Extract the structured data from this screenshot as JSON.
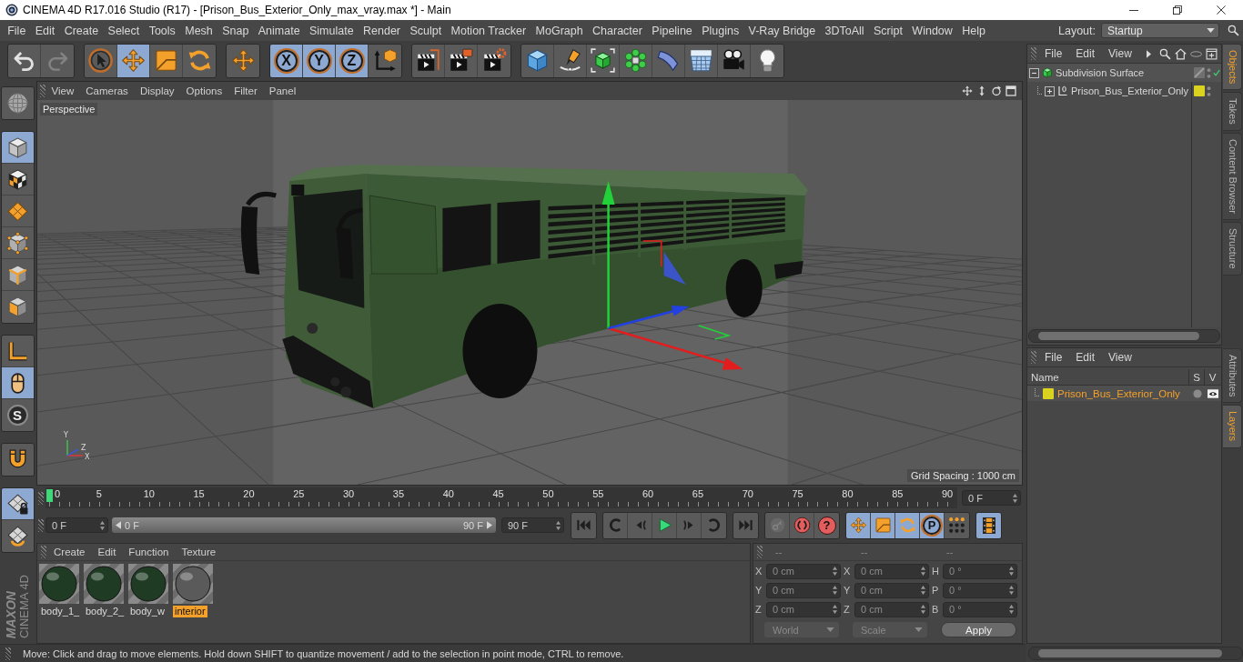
{
  "window": {
    "title": "CINEMA 4D R17.016 Studio (R17) - [Prison_Bus_Exterior_Only_max_vray.max *] - Main"
  },
  "menu_bar": {
    "items": [
      "File",
      "Edit",
      "Create",
      "Select",
      "Tools",
      "Mesh",
      "Snap",
      "Animate",
      "Simulate",
      "Render",
      "Sculpt",
      "Motion Tracker",
      "MoGraph",
      "Character",
      "Pipeline",
      "Plugins",
      "V-Ray Bridge",
      "3DToAll",
      "Script",
      "Window",
      "Help"
    ],
    "layout_label": "Layout:",
    "layout_value": "Startup"
  },
  "toolbar": {
    "groups": [
      [
        {
          "kind": "undo",
          "selected": false,
          "disabled": false
        },
        {
          "kind": "redo",
          "selected": false,
          "disabled": true
        }
      ],
      [
        {
          "kind": "live-select",
          "selected": false,
          "disabled": false
        },
        {
          "kind": "move",
          "selected": true,
          "disabled": false
        },
        {
          "kind": "scale",
          "selected": false,
          "disabled": false
        },
        {
          "kind": "rotate",
          "selected": false,
          "disabled": false
        }
      ],
      [
        {
          "kind": "recent",
          "selected": false,
          "disabled": false
        }
      ],
      [
        {
          "kind": "axis-lock",
          "label": "X",
          "selected": true,
          "disabled": false
        },
        {
          "kind": "axis-lock",
          "label": "Y",
          "selected": true,
          "disabled": false
        },
        {
          "kind": "axis-lock",
          "label": "Z",
          "selected": true,
          "disabled": false
        },
        {
          "kind": "coord-system",
          "selected": false,
          "disabled": false
        }
      ],
      [
        {
          "kind": "render-view",
          "selected": false,
          "disabled": false
        },
        {
          "kind": "render-picture",
          "selected": false,
          "disabled": false
        },
        {
          "kind": "render-settings",
          "selected": false,
          "disabled": false
        }
      ],
      [
        {
          "kind": "cube",
          "selected": false,
          "disabled": false
        },
        {
          "kind": "pen",
          "selected": false,
          "disabled": false
        },
        {
          "kind": "subdivision",
          "selected": false,
          "disabled": false
        },
        {
          "kind": "cloner",
          "selected": false,
          "disabled": false
        },
        {
          "kind": "deformer",
          "selected": false,
          "disabled": false
        },
        {
          "kind": "floor",
          "selected": false,
          "disabled": false
        },
        {
          "kind": "camera",
          "selected": false,
          "disabled": false
        },
        {
          "kind": "light",
          "selected": false,
          "disabled": false
        }
      ]
    ]
  },
  "left_toolbar": {
    "groups": [
      [
        {
          "kind": "make-editable",
          "selected": false
        }
      ],
      [
        {
          "kind": "model",
          "selected": true
        },
        {
          "kind": "texture",
          "selected": false
        },
        {
          "kind": "workplane",
          "selected": false
        },
        {
          "kind": "points",
          "selected": false
        },
        {
          "kind": "edges",
          "selected": false
        },
        {
          "kind": "polygons",
          "selected": false
        }
      ],
      [
        {
          "kind": "axis",
          "selected": false
        },
        {
          "kind": "tweak",
          "selected": true
        },
        {
          "kind": "snap",
          "label": "S",
          "selected": false
        }
      ],
      [
        {
          "kind": "magnet",
          "selected": false
        }
      ],
      [
        {
          "kind": "lock-workplane",
          "selected": true
        },
        {
          "kind": "planar-workplane",
          "selected": false
        }
      ]
    ]
  },
  "logo": {
    "brand": "MAXON",
    "product": "CINEMA 4D"
  },
  "viewport": {
    "menu": [
      "View",
      "Cameras",
      "Display",
      "Options",
      "Filter",
      "Panel"
    ],
    "camera": "Perspective",
    "axis_labels": [
      "Y",
      "Z",
      "X"
    ],
    "grid_spacing": "Grid Spacing : 1000 cm"
  },
  "timeline": {
    "ticks": [
      "0",
      "5",
      "10",
      "15",
      "20",
      "25",
      "30",
      "35",
      "40",
      "45",
      "50",
      "55",
      "60",
      "65",
      "70",
      "75",
      "80",
      "85",
      "90"
    ],
    "level": 0,
    "current_frame": "0 F"
  },
  "transport": {
    "start_frame": "0 F",
    "range": {
      "start": "0 F",
      "end": "90 F",
      "level": 1
    },
    "end_frame": "90 F",
    "groups": [
      [
        {
          "kind": "go-start",
          "selected": false,
          "disabled": false
        }
      ],
      [
        {
          "kind": "prev-key",
          "selected": false,
          "disabled": false
        },
        {
          "kind": "prev-frame",
          "selected": false,
          "disabled": false
        },
        {
          "kind": "play",
          "selected": false,
          "disabled": false
        },
        {
          "kind": "next-frame",
          "selected": false,
          "disabled": false
        },
        {
          "kind": "next-key",
          "selected": false,
          "disabled": false
        }
      ],
      [
        {
          "kind": "go-end",
          "selected": false,
          "disabled": false
        }
      ],
      [
        {
          "kind": "record",
          "selected": false,
          "disabled": true
        },
        {
          "kind": "autokey",
          "selected": false,
          "disabled": false
        },
        {
          "kind": "key-select",
          "label": "?",
          "selected": false,
          "disabled": false
        }
      ],
      [
        {
          "kind": "key-move",
          "selected": true,
          "disabled": false
        },
        {
          "kind": "key-scale",
          "selected": true,
          "disabled": false
        },
        {
          "kind": "key-rotate",
          "selected": true,
          "disabled": false
        },
        {
          "kind": "key-param",
          "label": "P",
          "selected": true,
          "disabled": false
        },
        {
          "kind": "key-pla",
          "selected": false,
          "disabled": false
        }
      ],
      [
        {
          "kind": "timeline",
          "selected": true,
          "disabled": false
        }
      ]
    ]
  },
  "materials": {
    "menu": [
      "Create",
      "Edit",
      "Function",
      "Texture"
    ],
    "items": [
      {
        "name": "body_1_",
        "color": "#1f3b24",
        "selected": false
      },
      {
        "name": "body_2_",
        "color": "#1f3b24",
        "selected": false
      },
      {
        "name": "body_w",
        "color": "#1f3b24",
        "selected": false
      },
      {
        "name": "interior",
        "color": "#5a5a5a",
        "selected": true
      }
    ]
  },
  "coordinates": {
    "headers": [
      "--",
      "--",
      "--"
    ],
    "rows": [
      [
        {
          "label": "X",
          "value": "0 cm"
        },
        {
          "label": "X",
          "value": "0 cm"
        },
        {
          "label": "H",
          "value": "0 °"
        }
      ],
      [
        {
          "label": "Y",
          "value": "0 cm"
        },
        {
          "label": "Y",
          "value": "0 cm"
        },
        {
          "label": "P",
          "value": "0 °"
        }
      ],
      [
        {
          "label": "Z",
          "value": "0 cm"
        },
        {
          "label": "Z",
          "value": "0 cm"
        },
        {
          "label": "B",
          "value": "0 °"
        }
      ]
    ],
    "dropdowns": [
      {
        "value": "World",
        "disabled": true
      },
      {
        "value": "Scale",
        "disabled": true
      }
    ],
    "apply": "Apply"
  },
  "objects": {
    "menu": [
      "File",
      "Edit",
      "View"
    ],
    "tree": [
      {
        "name": "Subdivision Surface",
        "kind": "subdivision",
        "expanded": true,
        "enabled": true,
        "children": [
          {
            "name": "Prison_Bus_Exterior_Only",
            "kind": "null",
            "expanded": false,
            "enabled": false,
            "color": "#d9d21f"
          }
        ]
      }
    ]
  },
  "object_tabs": [
    {
      "label": "Objects",
      "selected": true
    },
    {
      "label": "Takes",
      "selected": false
    },
    {
      "label": "Content Browser",
      "selected": false
    },
    {
      "label": "Structure",
      "selected": false
    }
  ],
  "layers": {
    "menu": [
      "File",
      "Edit",
      "View"
    ],
    "columns": [
      "Name",
      "S",
      "V"
    ],
    "rows": [
      {
        "name": "Prison_Bus_Exterior_Only",
        "color": "#d9d21f",
        "solo": false,
        "visible": true
      }
    ]
  },
  "layer_tabs": [
    {
      "label": "Attributes",
      "selected": false
    },
    {
      "label": "Layers",
      "selected": true
    }
  ],
  "status_bar": {
    "text": "Move: Click and drag to move elements. Hold down SHIFT to quantize movement / add to the selection in point mode, CTRL to remove."
  }
}
